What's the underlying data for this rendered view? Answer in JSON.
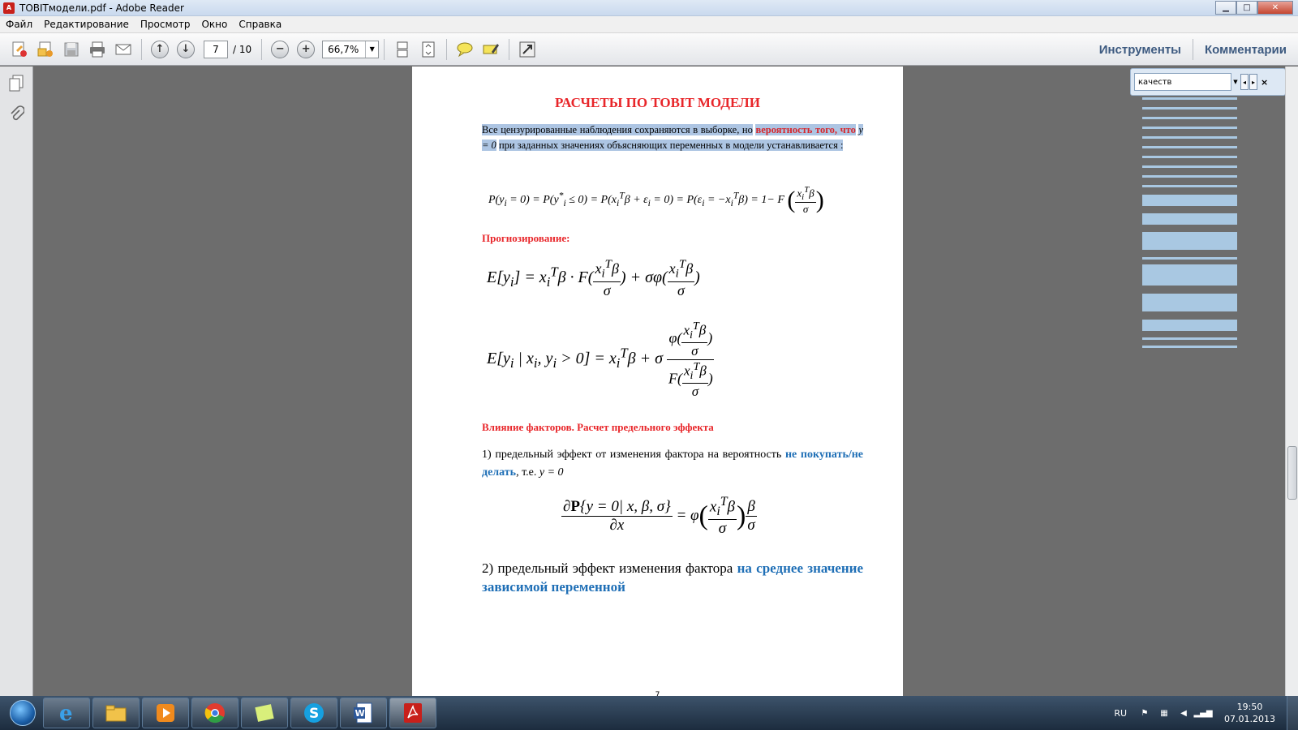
{
  "window": {
    "title": "TOBITмодели.pdf - Adobe Reader",
    "app_icon": "pdf-icon",
    "minimize": "▁",
    "maximize": "□",
    "close": "✕"
  },
  "menu": [
    "Файл",
    "Редактирование",
    "Просмотр",
    "Окно",
    "Справка"
  ],
  "toolbar": {
    "page_current": "7",
    "page_total": "/ 10",
    "zoom": "66,7%",
    "tools_label": "Инструменты",
    "comments_label": "Комментарии"
  },
  "search": {
    "value": "качеств",
    "prev": "◂",
    "next": "▸",
    "close": "×"
  },
  "document": {
    "title": "РАСЧЕТЫ ПО TOBIT МОДЕЛИ",
    "intro_part1": "Все цензурированные наблюдения сохраняются в выборке, но",
    "intro_bold": "вероятность того, что",
    "intro_y": "y = 0",
    "intro_part2": "при заданных значениях объясняющих переменных в модели устанавливается :",
    "heading_forecast": "Прогнозирование:",
    "heading_influence": "Влияние факторов. Расчет предельного эффекта",
    "item1_text": "1) предельный эффект от изменения фактора на вероятность",
    "item1_blue": "не покупать/не делать",
    "item1_tail": ", т.е.",
    "item1_y": "y = 0",
    "item2_text": "2) предельный эффект изменения фактора",
    "item2_blue": "на среднее значение зависимой переменной",
    "page_number": "7"
  },
  "taskbar": {
    "apps": [
      "internet-explorer-icon",
      "explorer-folder-icon",
      "media-player-icon",
      "chrome-icon",
      "sticky-notes-icon",
      "skype-icon",
      "word-icon",
      "adobe-reader-icon"
    ],
    "language": "RU",
    "time": "19:50",
    "date": "07.01.2013"
  }
}
